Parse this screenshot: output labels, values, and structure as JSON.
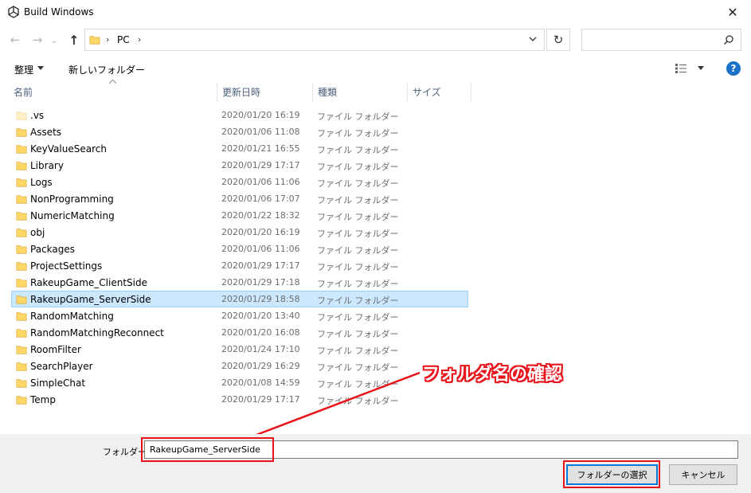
{
  "window": {
    "title": "Build Windows",
    "close_glyph": "✕"
  },
  "nav": {
    "back_glyph": "←",
    "forward_glyph": "→",
    "recent_glyph": "⌄",
    "up_glyph": "↑",
    "breadcrumb_sep": "›",
    "breadcrumb": "PC",
    "refresh_glyph": "↻",
    "search_placeholder": ""
  },
  "toolbar": {
    "organize_label": "整理",
    "new_folder_label": "新しいフォルダー",
    "help_label": "?"
  },
  "columns": {
    "name": "名前",
    "modified": "更新日時",
    "type": "種類",
    "size": "サイズ"
  },
  "files": [
    {
      "name": ".vs",
      "date": "2020/01/20 16:19",
      "type": "ファイル フォルダー",
      "faded": true
    },
    {
      "name": "Assets",
      "date": "2020/01/06 11:08",
      "type": "ファイル フォルダー"
    },
    {
      "name": "KeyValueSearch",
      "date": "2020/01/21 16:55",
      "type": "ファイル フォルダー"
    },
    {
      "name": "Library",
      "date": "2020/01/29 17:17",
      "type": "ファイル フォルダー"
    },
    {
      "name": "Logs",
      "date": "2020/01/06 11:06",
      "type": "ファイル フォルダー"
    },
    {
      "name": "NonProgramming",
      "date": "2020/01/06 17:07",
      "type": "ファイル フォルダー"
    },
    {
      "name": "NumericMatching",
      "date": "2020/01/22 18:32",
      "type": "ファイル フォルダー"
    },
    {
      "name": "obj",
      "date": "2020/01/20 16:19",
      "type": "ファイル フォルダー"
    },
    {
      "name": "Packages",
      "date": "2020/01/06 11:06",
      "type": "ファイル フォルダー"
    },
    {
      "name": "ProjectSettings",
      "date": "2020/01/29 17:17",
      "type": "ファイル フォルダー"
    },
    {
      "name": "RakeupGame_ClientSide",
      "date": "2020/01/29 17:18",
      "type": "ファイル フォルダー"
    },
    {
      "name": "RakeupGame_ServerSide",
      "date": "2020/01/29 18:58",
      "type": "ファイル フォルダー",
      "selected": true
    },
    {
      "name": "RandomMatching",
      "date": "2020/01/20 13:40",
      "type": "ファイル フォルダー"
    },
    {
      "name": "RandomMatchingReconnect",
      "date": "2020/01/20 16:08",
      "type": "ファイル フォルダー"
    },
    {
      "name": "RoomFilter",
      "date": "2020/01/24 17:10",
      "type": "ファイル フォルダー"
    },
    {
      "name": "SearchPlayer",
      "date": "2020/01/29 16:29",
      "type": "ファイル フォルダー"
    },
    {
      "name": "SimpleChat",
      "date": "2020/01/08 14:59",
      "type": "ファイル フォルダー"
    },
    {
      "name": "Temp",
      "date": "2020/01/29 17:17",
      "type": "ファイル フォルダー"
    }
  ],
  "annotation": {
    "text": "フォルダ名の確認",
    "color": "#e8141b"
  },
  "bottom": {
    "folder_label": "フォルダー:",
    "folder_value": "RakeupGame_ServerSide",
    "select_button": "フォルダーの選択",
    "cancel_button": "キャンセル"
  },
  "colors": {
    "selection_bg": "#cce8ff",
    "folder_yellow": "#ffd766",
    "accent_blue": "#0078d7"
  }
}
